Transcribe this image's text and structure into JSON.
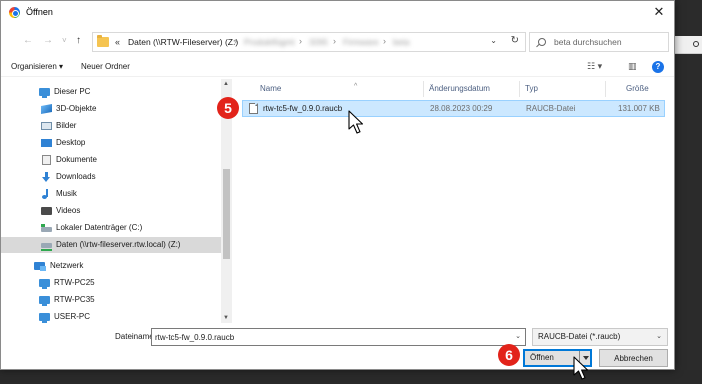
{
  "window": {
    "title": "Öffnen",
    "close_glyph": "✕"
  },
  "nav": {
    "back_glyph": "←",
    "forward_glyph": "→",
    "recent_glyph": "˅",
    "up_glyph": "↑",
    "breadcrumb_chevron": "«",
    "breadcrumb_current": "Daten (\\\\RTW-Fileserver) (Z:)",
    "breadcrumb_hidden": [
      "Produktfügmt",
      "3265",
      "Firmware",
      "beta"
    ],
    "dropdown_glyph": "⌄",
    "refresh_glyph": "↻",
    "search_placeholder": "beta durchsuchen"
  },
  "toolbar": {
    "organize_label": "Organisieren ▾",
    "new_folder_label": "Neuer Ordner",
    "view_glyph": "☷ ▾",
    "pane_glyph": "▥",
    "help_glyph": "?"
  },
  "sidebar": {
    "items": [
      {
        "label": "Dieser PC",
        "icon": "pc-icon"
      },
      {
        "label": "3D-Objekte",
        "icon": "cube-icon"
      },
      {
        "label": "Bilder",
        "icon": "pictures-icon"
      },
      {
        "label": "Desktop",
        "icon": "desktop-icon"
      },
      {
        "label": "Dokumente",
        "icon": "documents-icon"
      },
      {
        "label": "Downloads",
        "icon": "download-icon"
      },
      {
        "label": "Musik",
        "icon": "music-icon"
      },
      {
        "label": "Videos",
        "icon": "video-icon"
      },
      {
        "label": "Lokaler Datenträger (C:)",
        "icon": "drive-icon"
      },
      {
        "label": "Daten (\\\\rtw-fileserver.rtw.local) (Z:)",
        "icon": "network-drive-icon"
      },
      {
        "label": "Netzwerk",
        "icon": "network-icon"
      },
      {
        "label": "RTW-PC25",
        "icon": "computer-icon"
      },
      {
        "label": "RTW-PC35",
        "icon": "computer-icon"
      },
      {
        "label": "USER-PC",
        "icon": "computer-icon"
      }
    ]
  },
  "columns": {
    "name": "Name",
    "date": "Änderungsdatum",
    "type": "Typ",
    "size": "Größe",
    "sort_glyph": "^"
  },
  "files": [
    {
      "name": "rtw-tc5-fw_0.9.0.raucb",
      "date": "28.08.2023 00:29",
      "type": "RAUCB-Datei",
      "size": "131.007 KB"
    }
  ],
  "footer": {
    "filename_label": "Dateiname:",
    "filename_value": "rtw-tc5-fw_0.9.0.raucb",
    "filetype_value": "RAUCB-Datei (*.raucb)",
    "dropdown_glyph": "⌄",
    "open_label": "Öffnen",
    "cancel_label": "Abbrechen"
  },
  "annotations": {
    "step5": "5",
    "step6": "6",
    "badge_color": "#e2231a"
  },
  "colors": {
    "selection": "#cce8ff",
    "selection_border": "#99d1ff",
    "accent": "#0078d7"
  }
}
